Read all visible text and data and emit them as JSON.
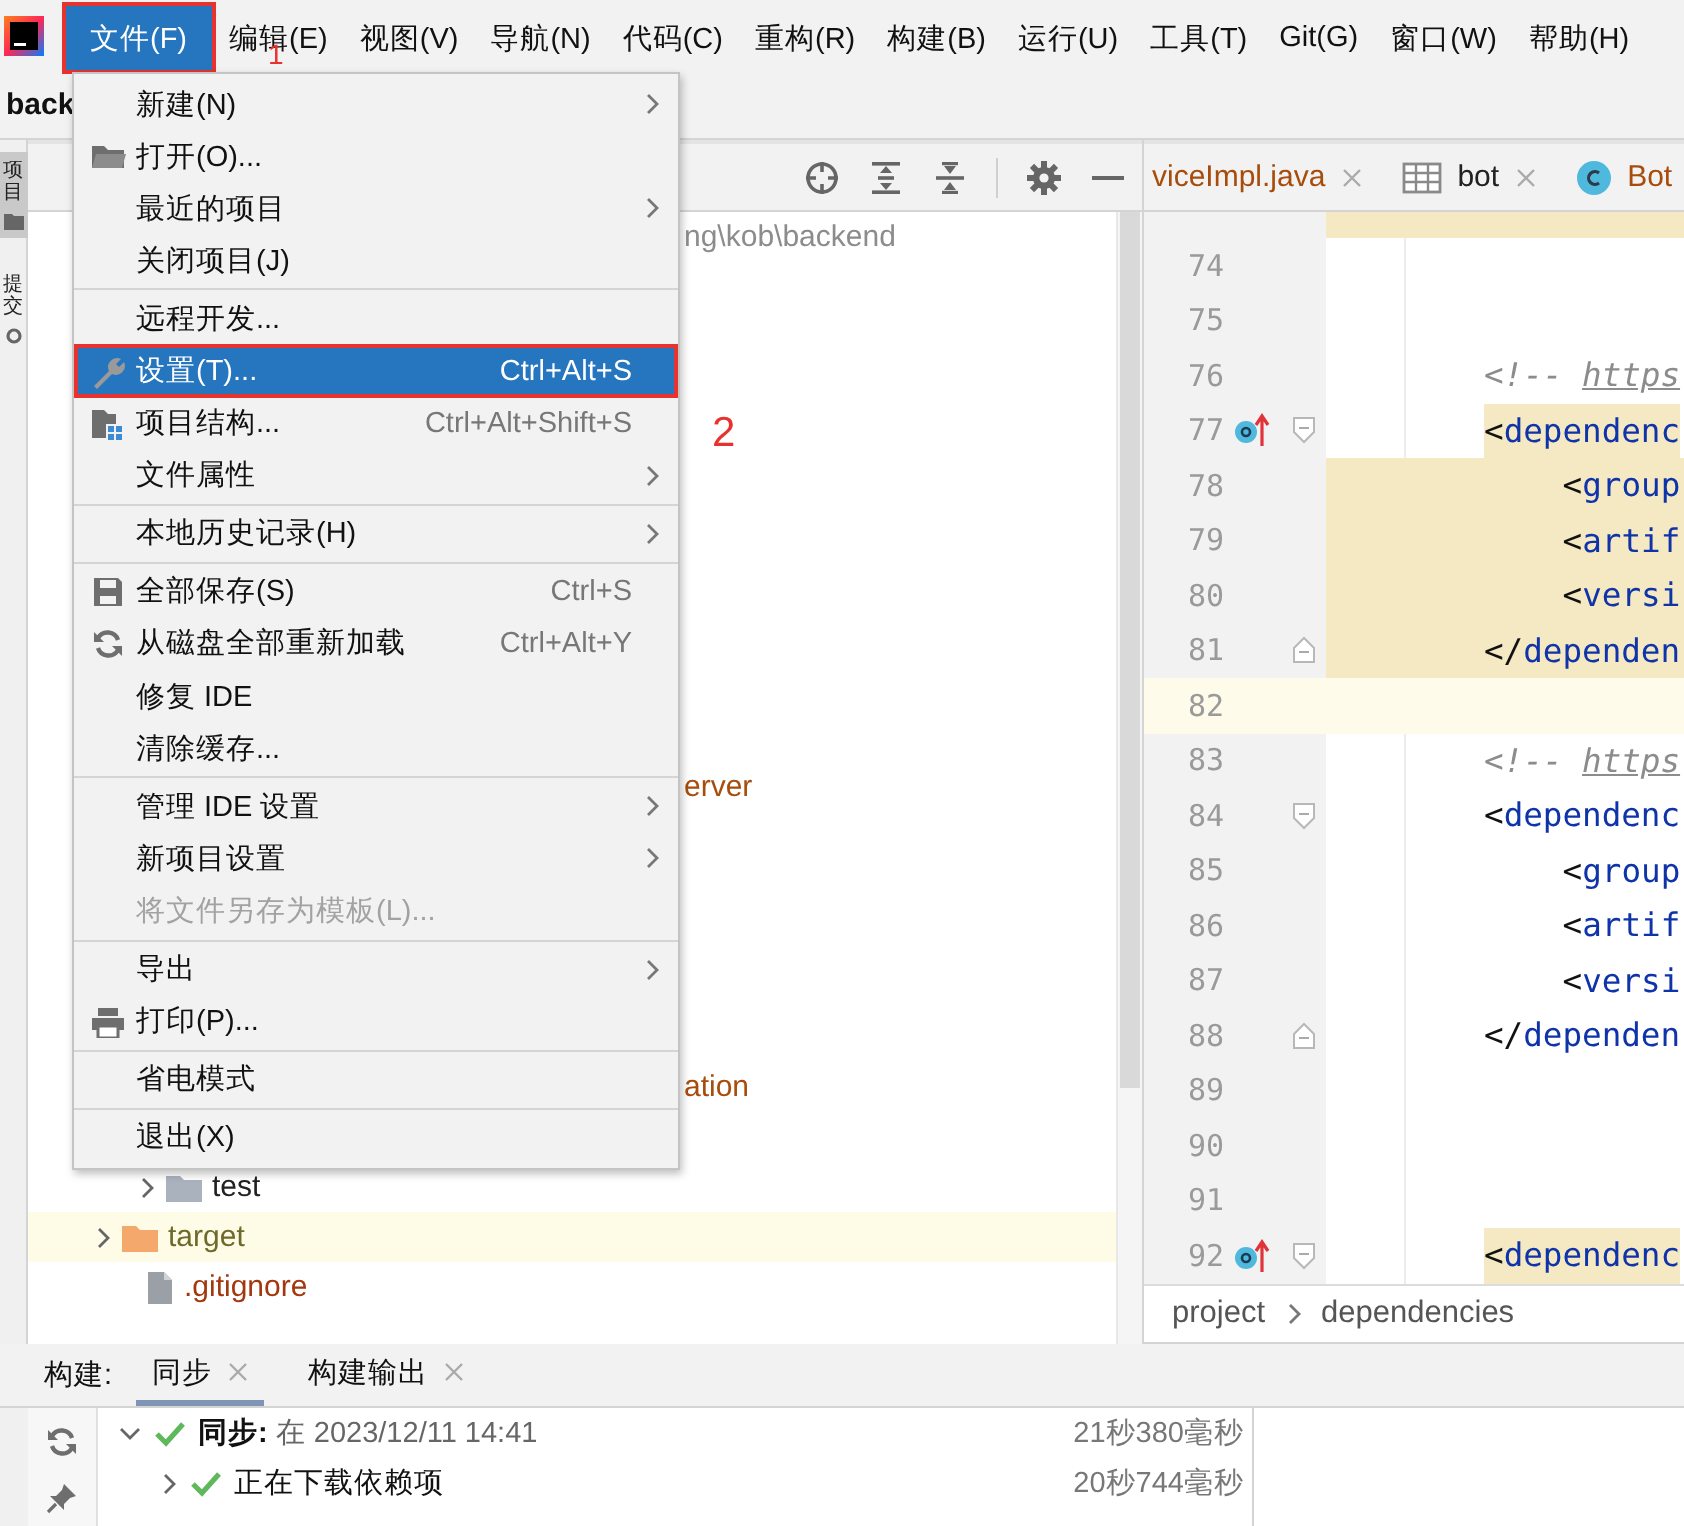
{
  "menubar": {
    "items": [
      {
        "label": "文件(F)",
        "selected": true,
        "annotated": true
      },
      {
        "label": "编辑(E)",
        "selected": false,
        "annotated": false
      },
      {
        "label": "视图(V)",
        "selected": false,
        "annotated": false
      },
      {
        "label": "导航(N)",
        "selected": false,
        "annotated": false
      },
      {
        "label": "代码(C)",
        "selected": false,
        "annotated": false
      },
      {
        "label": "重构(R)",
        "selected": false,
        "annotated": false
      },
      {
        "label": "构建(B)",
        "selected": false,
        "annotated": false
      },
      {
        "label": "运行(U)",
        "selected": false,
        "annotated": false
      },
      {
        "label": "工具(T)",
        "selected": false,
        "annotated": false
      },
      {
        "label": "Git(G)",
        "selected": false,
        "annotated": false
      },
      {
        "label": "窗口(W)",
        "selected": false,
        "annotated": false
      },
      {
        "label": "帮助(H)",
        "selected": false,
        "annotated": false
      }
    ]
  },
  "title": "back",
  "file_menu": {
    "items": [
      {
        "kind": "item",
        "label": "新建(N)",
        "submenu": true,
        "disabled": false,
        "selected": false,
        "annotated": false
      },
      {
        "kind": "item",
        "label": "打开(O)...",
        "submenu": false,
        "disabled": false,
        "selected": false,
        "annotated": false
      },
      {
        "kind": "item",
        "label": "最近的项目",
        "submenu": true,
        "disabled": false,
        "selected": false,
        "annotated": false
      },
      {
        "kind": "item",
        "label": "关闭项目(J)",
        "submenu": false,
        "disabled": false,
        "selected": false,
        "annotated": false
      },
      {
        "kind": "separator"
      },
      {
        "kind": "item",
        "label": "远程开发...",
        "submenu": false,
        "disabled": false,
        "selected": false,
        "annotated": false
      },
      {
        "kind": "item",
        "label": "设置(T)...",
        "shortcut": "Ctrl+Alt+S",
        "submenu": false,
        "disabled": false,
        "selected": true,
        "annotated": true
      },
      {
        "kind": "item",
        "label": "项目结构...",
        "shortcut": "Ctrl+Alt+Shift+S",
        "submenu": false,
        "disabled": false,
        "selected": false,
        "annotated": false
      },
      {
        "kind": "item",
        "label": "文件属性",
        "submenu": true,
        "disabled": false,
        "selected": false,
        "annotated": false
      },
      {
        "kind": "separator"
      },
      {
        "kind": "item",
        "label": "本地历史记录(H)",
        "submenu": true,
        "disabled": false,
        "selected": false,
        "annotated": false
      },
      {
        "kind": "separator"
      },
      {
        "kind": "item",
        "label": "全部保存(S)",
        "shortcut": "Ctrl+S",
        "submenu": false,
        "disabled": false,
        "selected": false,
        "annotated": false
      },
      {
        "kind": "item",
        "label": "从磁盘全部重新加载",
        "shortcut": "Ctrl+Alt+Y",
        "submenu": false,
        "disabled": false,
        "selected": false,
        "annotated": false
      },
      {
        "kind": "item",
        "label": "修复 IDE",
        "submenu": false,
        "disabled": false,
        "selected": false,
        "annotated": false
      },
      {
        "kind": "item",
        "label": "清除缓存...",
        "submenu": false,
        "disabled": false,
        "selected": false,
        "annotated": false
      },
      {
        "kind": "separator"
      },
      {
        "kind": "item",
        "label": "管理 IDE 设置",
        "submenu": true,
        "disabled": false,
        "selected": false,
        "annotated": false
      },
      {
        "kind": "item",
        "label": "新项目设置",
        "submenu": true,
        "disabled": false,
        "selected": false,
        "annotated": false
      },
      {
        "kind": "item",
        "label": "将文件另存为模板(L)...",
        "submenu": false,
        "disabled": true,
        "selected": false,
        "annotated": false
      },
      {
        "kind": "separator"
      },
      {
        "kind": "item",
        "label": "导出",
        "submenu": true,
        "disabled": false,
        "selected": false,
        "annotated": false
      },
      {
        "kind": "item",
        "label": "打印(P)...",
        "submenu": false,
        "disabled": false,
        "selected": false,
        "annotated": false
      },
      {
        "kind": "separator"
      },
      {
        "kind": "item",
        "label": "省电模式",
        "submenu": false,
        "disabled": false,
        "selected": false,
        "annotated": false
      },
      {
        "kind": "separator"
      },
      {
        "kind": "item",
        "label": "退出(X)",
        "submenu": false,
        "disabled": false,
        "selected": false,
        "annotated": false
      }
    ]
  },
  "annotations": [
    {
      "label": "1"
    },
    {
      "label": "2"
    }
  ],
  "left_strip": {
    "tabs": [
      {
        "label": "项目",
        "selected": true
      },
      {
        "label": "提交",
        "selected": false
      }
    ]
  },
  "project": {
    "tree": [
      {
        "kind": "path",
        "label": "ng\\kob\\backend",
        "color": "#8c8c8c",
        "selected": false
      },
      {
        "kind": "fragment",
        "label": "erver",
        "color": "#a84c0c",
        "selected": false
      },
      {
        "kind": "fragment",
        "label": "ation",
        "color": "#a84c0c",
        "selected": false
      },
      {
        "kind": "folder",
        "label": "test",
        "color": "#222222",
        "selected": false,
        "expanded": false,
        "excluded": false
      },
      {
        "kind": "folder",
        "label": "target",
        "color": "#6e6a2a",
        "selected": true,
        "expanded": false,
        "excluded": true
      },
      {
        "kind": "file",
        "label": ".gitignore",
        "color": "#a3370e",
        "selected": false
      }
    ]
  },
  "editor": {
    "tabs": [
      {
        "label": "viceImpl.java",
        "closable": true,
        "color": "#a84c0c"
      },
      {
        "label": "bot",
        "closable": true,
        "color": "#222222"
      },
      {
        "label": "Bot",
        "closable": false,
        "color": "#a84c0c"
      }
    ],
    "lines": [
      {
        "number": "74",
        "kind": "blank",
        "highlighted": false,
        "current": false,
        "marker": false,
        "fold_start": false,
        "fold_end": false
      },
      {
        "number": "75",
        "kind": "blank",
        "highlighted": false,
        "current": false,
        "marker": false,
        "fold_start": false,
        "fold_end": false
      },
      {
        "number": "76",
        "kind": "comment",
        "text": "<!--",
        "link": "https",
        "highlighted": false,
        "current": false,
        "marker": false,
        "fold_start": false,
        "fold_end": false
      },
      {
        "number": "77",
        "kind": "tag",
        "text": "<dependenc",
        "highlighted": true,
        "current": false,
        "marker": true,
        "fold_start": true,
        "fold_end": false,
        "children": [
          {
            "number": "78",
            "kind": "tag",
            "text": "<group",
            "highlighted": true,
            "current": false,
            "marker": false,
            "fold_start": false,
            "fold_end": false
          },
          {
            "number": "79",
            "kind": "tag",
            "text": "<artif",
            "highlighted": true,
            "current": false,
            "marker": false,
            "fold_start": false,
            "fold_end": false
          },
          {
            "number": "80",
            "kind": "tag",
            "text": "<versi",
            "highlighted": true,
            "current": false,
            "marker": false,
            "fold_start": false,
            "fold_end": false
          }
        ]
      },
      {
        "number": "81",
        "kind": "tag",
        "text": "</dependen",
        "highlighted": true,
        "current": false,
        "marker": false,
        "fold_start": false,
        "fold_end": true
      },
      {
        "number": "82",
        "kind": "blank",
        "highlighted": false,
        "current": true,
        "marker": false,
        "fold_start": false,
        "fold_end": false
      },
      {
        "number": "83",
        "kind": "comment",
        "text": "<!--",
        "link": "https",
        "highlighted": false,
        "current": false,
        "marker": false,
        "fold_start": false,
        "fold_end": false
      },
      {
        "number": "84",
        "kind": "tag",
        "text": "<dependenc",
        "highlighted": false,
        "current": false,
        "marker": false,
        "fold_start": true,
        "fold_end": false,
        "children": [
          {
            "number": "85",
            "kind": "tag",
            "text": "<group",
            "highlighted": false,
            "current": false,
            "marker": false,
            "fold_start": false,
            "fold_end": false
          },
          {
            "number": "86",
            "kind": "tag",
            "text": "<artif",
            "highlighted": false,
            "current": false,
            "marker": false,
            "fold_start": false,
            "fold_end": false
          },
          {
            "number": "87",
            "kind": "tag",
            "text": "<versi",
            "highlighted": false,
            "current": false,
            "marker": false,
            "fold_start": false,
            "fold_end": false
          }
        ]
      },
      {
        "number": "88",
        "kind": "tag",
        "text": "</dependen",
        "highlighted": false,
        "current": false,
        "marker": false,
        "fold_start": false,
        "fold_end": true
      },
      {
        "number": "89",
        "kind": "blank",
        "highlighted": false,
        "current": false,
        "marker": false,
        "fold_start": false,
        "fold_end": false
      },
      {
        "number": "90",
        "kind": "blank",
        "highlighted": false,
        "current": false,
        "marker": false,
        "fold_start": false,
        "fold_end": false
      },
      {
        "number": "91",
        "kind": "blank",
        "highlighted": false,
        "current": false,
        "marker": false,
        "fold_start": false,
        "fold_end": false
      },
      {
        "number": "92",
        "kind": "tag",
        "text": "<dependenc",
        "highlighted": true,
        "current": false,
        "marker": true,
        "fold_start": true,
        "fold_end": false
      }
    ],
    "breadcrumbs": [
      "project",
      "dependencies"
    ]
  },
  "build": {
    "label": "构建:",
    "tabs": [
      {
        "label": "同步",
        "selected": true
      },
      {
        "label": "构建输出",
        "selected": false
      }
    ],
    "rows": [
      {
        "text": "**同步:** 在 2023/12/11 14:41",
        "time": "21秒380毫秒",
        "expanded": true,
        "children": [
          {
            "text": "正在下载依赖项",
            "time": "20秒744毫秒",
            "expanded": false
          }
        ]
      }
    ]
  }
}
